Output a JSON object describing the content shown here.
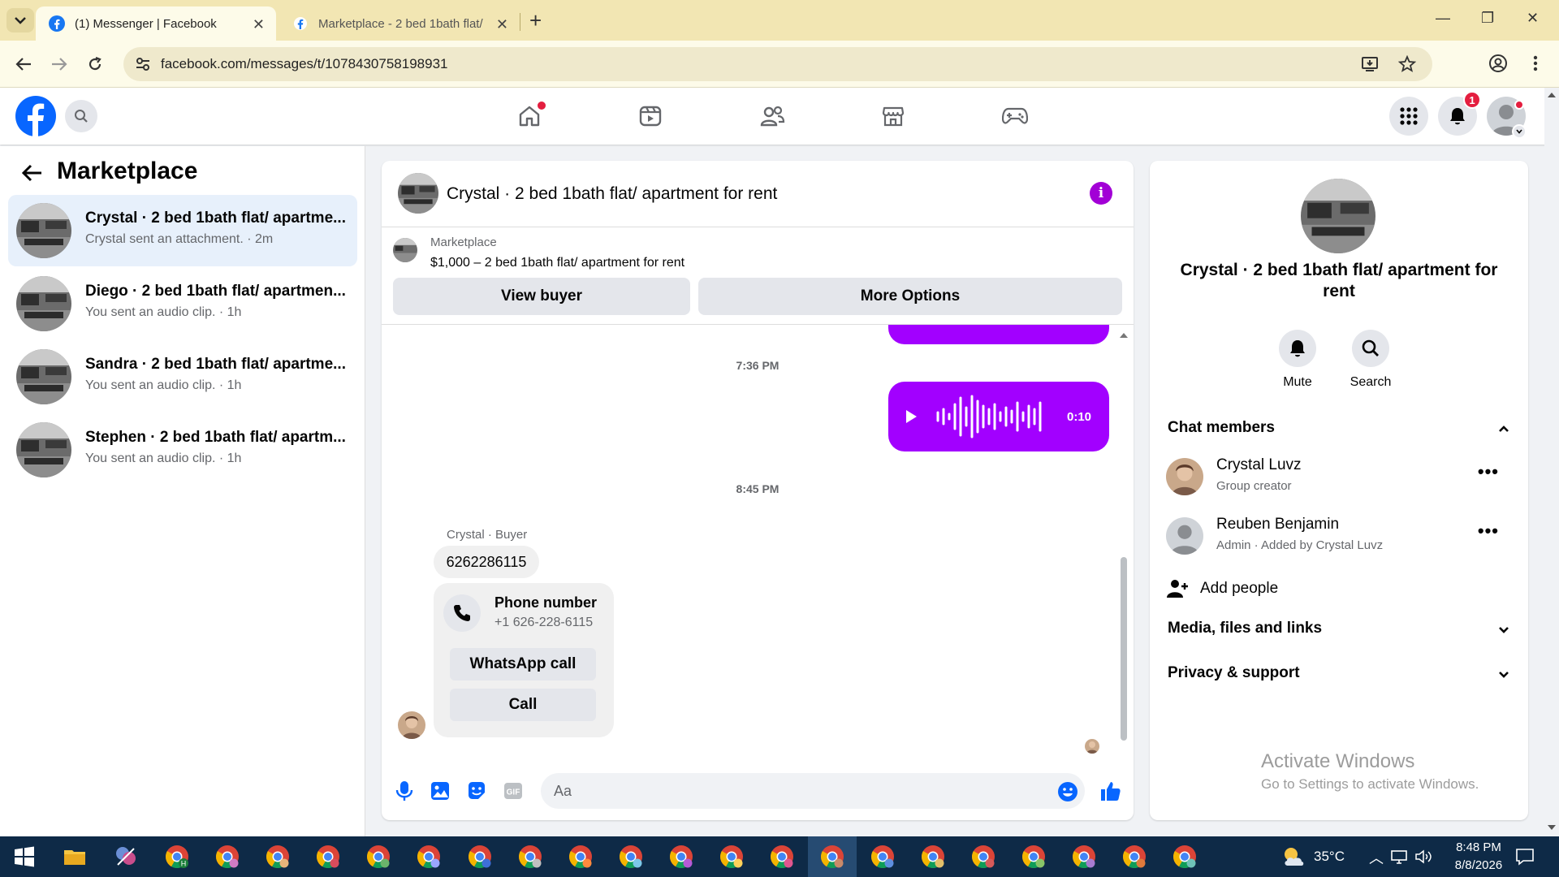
{
  "browser": {
    "tabs": [
      {
        "title": "(1) Messenger | Facebook",
        "active": true
      },
      {
        "title": "Marketplace - 2 bed 1bath flat/",
        "active": false
      }
    ],
    "url": "facebook.com/messages/t/1078430758198931"
  },
  "fbnav": {
    "notification_count": "1"
  },
  "left_panel": {
    "title": "Marketplace",
    "conversations": [
      {
        "name": "Crystal · 2 bed 1bath flat/ apartme...",
        "preview": "Crystal sent an attachment. · 2m",
        "selected": true
      },
      {
        "name": "Diego · 2 bed 1bath flat/ apartmen...",
        "preview": "You sent an audio clip. · 1h",
        "selected": false
      },
      {
        "name": "Sandra · 2 bed 1bath flat/ apartme...",
        "preview": "You sent an audio clip. · 1h",
        "selected": false
      },
      {
        "name": "Stephen · 2 bed 1bath flat/ apartm...",
        "preview": "You sent an audio clip. · 1h",
        "selected": false
      }
    ]
  },
  "chat": {
    "title": "Crystal · 2 bed 1bath flat/ apartment for rent",
    "marketplace_label": "Marketplace",
    "listing": "$1,000 – 2 bed 1bath flat/ apartment for rent",
    "view_buyer": "View buyer",
    "more_options": "More Options",
    "time1": "7:36 PM",
    "audio_duration": "0:10",
    "time2": "8:45 PM",
    "sender_label": "Crystal · Buyer",
    "phone_message": "6262286115",
    "contact_card": {
      "title": "Phone number",
      "number": "+1 626-228-6115",
      "whatsapp": "WhatsApp call",
      "call": "Call"
    },
    "input_placeholder": "Aa",
    "accent": "#a200ff"
  },
  "right_panel": {
    "name": "Crystal · 2 bed 1bath flat/ apartment for rent",
    "mute": "Mute",
    "search": "Search",
    "chat_members": "Chat members",
    "members": [
      {
        "name": "Crystal Luvz",
        "role": "Group creator"
      },
      {
        "name": "Reuben Benjamin",
        "role": "Admin · Added by Crystal Luvz"
      }
    ],
    "add_people": "Add people",
    "media": "Media, files and links",
    "privacy": "Privacy & support"
  },
  "watermark": {
    "line1": "Activate Windows",
    "line2": "Go to Settings to activate Windows."
  },
  "taskbar": {
    "temperature": "35°C",
    "time": "8:48 PM",
    "date": "8/8/2026"
  }
}
